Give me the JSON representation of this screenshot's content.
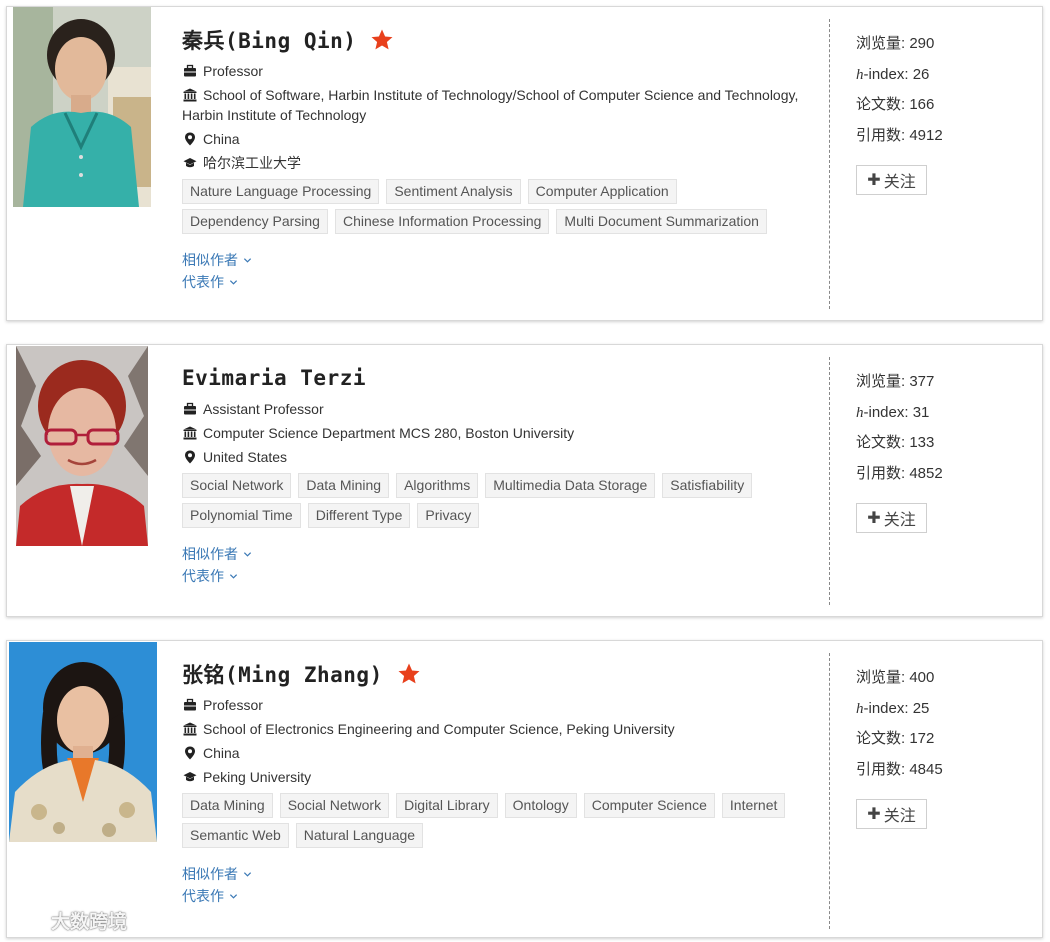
{
  "scholars": [
    {
      "name": "秦兵(Bing Qin)",
      "starred": true,
      "position": "Professor",
      "affiliation": "School of Software, Harbin Institute of Technology/School of Computer Science and Technology, Harbin Institute of Technology",
      "location": "China",
      "education": "哈尔滨工业大学",
      "tags": [
        "Nature Language Processing",
        "Sentiment Analysis",
        "Computer Application",
        "Dependency Parsing",
        "Chinese Information Processing",
        "Multi Document Summarization"
      ],
      "similar_authors_label": "相似作者",
      "representative_works_label": "代表作",
      "views_label": "浏览量:",
      "views": "290",
      "hindex_prefix": "h",
      "hindex_label": "-index:",
      "hindex": "26",
      "papers_label": "论文数:",
      "papers": "166",
      "citations_label": "引用数:",
      "citations": "4912",
      "follow_label": "关注"
    },
    {
      "name": "Evimaria Terzi",
      "starred": false,
      "position": "Assistant Professor",
      "affiliation": "Computer Science Department MCS 280, Boston University",
      "location": "United States",
      "education": "",
      "tags": [
        "Social Network",
        "Data Mining",
        "Algorithms",
        "Multimedia Data Storage",
        "Satisfiability",
        "Polynomial Time",
        "Different Type",
        "Privacy"
      ],
      "similar_authors_label": "相似作者",
      "representative_works_label": "代表作",
      "views_label": "浏览量:",
      "views": "377",
      "hindex_prefix": "h",
      "hindex_label": "-index:",
      "hindex": "31",
      "papers_label": "论文数:",
      "papers": "133",
      "citations_label": "引用数:",
      "citations": "4852",
      "follow_label": "关注"
    },
    {
      "name": "张铭(Ming Zhang)",
      "starred": true,
      "position": "Professor",
      "affiliation": "School of Electronics Engineering and Computer Science, Peking University",
      "location": "China",
      "education": "Peking University",
      "tags": [
        "Data Mining",
        "Social Network",
        "Digital Library",
        "Ontology",
        "Computer Science",
        "Internet",
        "Semantic Web",
        "Natural Language"
      ],
      "similar_authors_label": "相似作者",
      "representative_works_label": "代表作",
      "views_label": "浏览量:",
      "views": "400",
      "hindex_prefix": "h",
      "hindex_label": "-index:",
      "hindex": "25",
      "papers_label": "论文数:",
      "papers": "172",
      "citations_label": "引用数:",
      "citations": "4845",
      "follow_label": "关注"
    }
  ],
  "watermark": "大数跨境",
  "colors": {
    "star": "#e8401c",
    "link": "#3a78b5",
    "divider": "#888888"
  }
}
